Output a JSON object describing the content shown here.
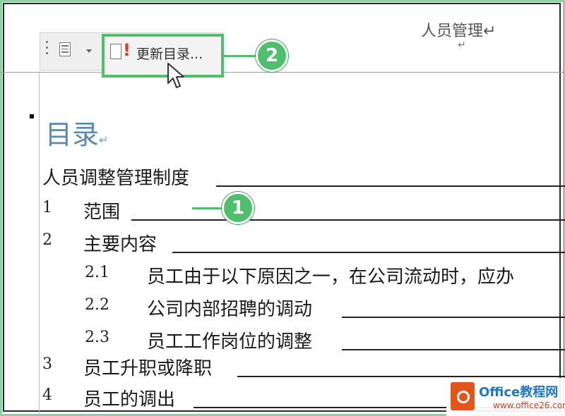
{
  "header": {
    "text": "人员管理↵",
    "paragraph_mark": "↵"
  },
  "toolbar": {
    "update_button_label": "更新目录...",
    "update_icon_excl": "!",
    "icons": [
      "drag-grip-icon",
      "document-menu-icon",
      "chevron-down-icon",
      "update-document-icon",
      "cursor-arrow-icon"
    ]
  },
  "callouts": [
    {
      "label": "1"
    },
    {
      "label": "2"
    }
  ],
  "toc": {
    "title": "目录",
    "title_mark": "↵",
    "entries": [
      {
        "num": "",
        "text": "人员调整管理制度"
      },
      {
        "num": "1",
        "text": "范围"
      },
      {
        "num": "2",
        "text": "主要内容"
      },
      {
        "num": "2.1",
        "text": "员工由于以下原因之一，在公司流动时，应办"
      },
      {
        "num": "2.2",
        "text": "公司内部招聘的调动"
      },
      {
        "num": "2.3",
        "text": "员工工作岗位的调整"
      },
      {
        "num": "3",
        "text": "员工升职或降职"
      },
      {
        "num": "4",
        "text": "员工的调出"
      }
    ]
  },
  "watermark": {
    "main": "Office教程网",
    "sub": "www.office26.com"
  },
  "colors": {
    "accent_green": "#4fbf6e",
    "title_blue": "#5b8ab0",
    "excl_red": "#e03a1a",
    "logo_orange": "#e2561b"
  }
}
